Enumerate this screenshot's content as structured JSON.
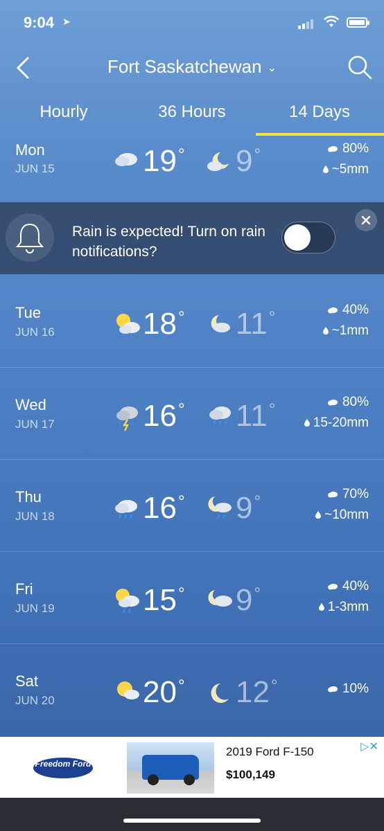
{
  "status": {
    "time": "9:04"
  },
  "header": {
    "city": "Fort Saskatchewan"
  },
  "tabs": [
    {
      "label": "Hourly"
    },
    {
      "label": "36 Hours"
    },
    {
      "label": "14 Days",
      "active": true
    }
  ],
  "days": [
    {
      "day": "Mon",
      "date": "JUN 15",
      "hi": "19",
      "lo": "9",
      "pop": "80%",
      "amount": "~5mm",
      "day_icon": "rain-cloud-icon",
      "night_icon": "moon-cloud-icon"
    },
    {
      "day": "Tue",
      "date": "JUN 16",
      "hi": "18",
      "lo": "11",
      "pop": "40%",
      "amount": "~1mm",
      "day_icon": "sun-cloud-icon",
      "night_icon": "moon-cloud-icon"
    },
    {
      "day": "Wed",
      "date": "JUN 17",
      "hi": "16",
      "lo": "11",
      "pop": "80%",
      "amount": "15-20mm",
      "day_icon": "thunderstorm-icon",
      "night_icon": "rain-cloud-icon"
    },
    {
      "day": "Thu",
      "date": "JUN 18",
      "hi": "16",
      "lo": "9",
      "pop": "70%",
      "amount": "~10mm",
      "day_icon": "rain-cloud-icon",
      "night_icon": "moon-rain-icon"
    },
    {
      "day": "Fri",
      "date": "JUN 19",
      "hi": "15",
      "lo": "9",
      "pop": "40%",
      "amount": "1-3mm",
      "day_icon": "sun-rain-icon",
      "night_icon": "moon-cloud-icon"
    },
    {
      "day": "Sat",
      "date": "JUN 20",
      "hi": "20",
      "lo": "12",
      "pop": "10%",
      "amount": "",
      "day_icon": "sun-cloud-icon",
      "night_icon": "moon-icon"
    }
  ],
  "banner": {
    "text": "Rain is expected! Turn on rain notifications?"
  },
  "ad": {
    "logo": "Freedom Ford",
    "title": "2019 Ford F-150",
    "price": "$100,149"
  },
  "colors": {
    "accent": "#f5e14a",
    "background": "#4e80c4"
  }
}
